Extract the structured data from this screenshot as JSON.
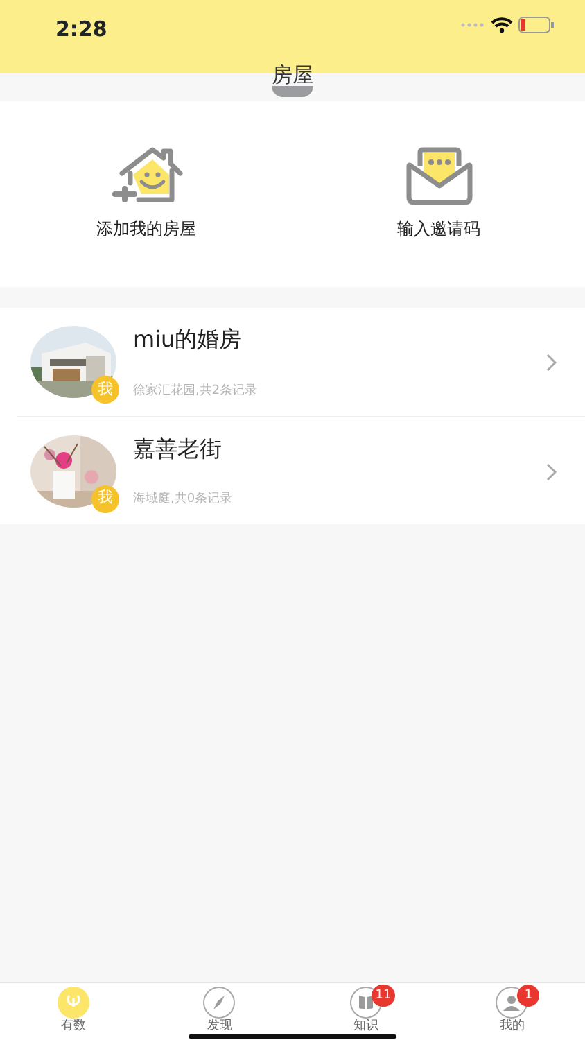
{
  "status_bar": {
    "time": "2:28"
  },
  "header": {
    "title": "房屋"
  },
  "actions": [
    {
      "kind": "add-house",
      "label": "添加我的房屋"
    },
    {
      "kind": "invite-code",
      "label": "输入邀请码"
    }
  ],
  "houses": [
    {
      "name": "miu的婚房",
      "badge": "我",
      "detail": "徐家汇花园,共2条记录",
      "kind": "picture"
    },
    {
      "name": "嘉善老街",
      "badge": "我",
      "detail": "海域庭,共0条记录",
      "kind": "picture"
    }
  ],
  "tabs": [
    {
      "kind": "home",
      "label": "有数",
      "selected": true
    },
    {
      "kind": "compass",
      "label": "发现",
      "selected": false
    },
    {
      "kind": "book",
      "label": "知识",
      "selected": false,
      "badge": "11"
    },
    {
      "kind": "person",
      "label": "我的",
      "selected": false,
      "badge": "1"
    }
  ]
}
